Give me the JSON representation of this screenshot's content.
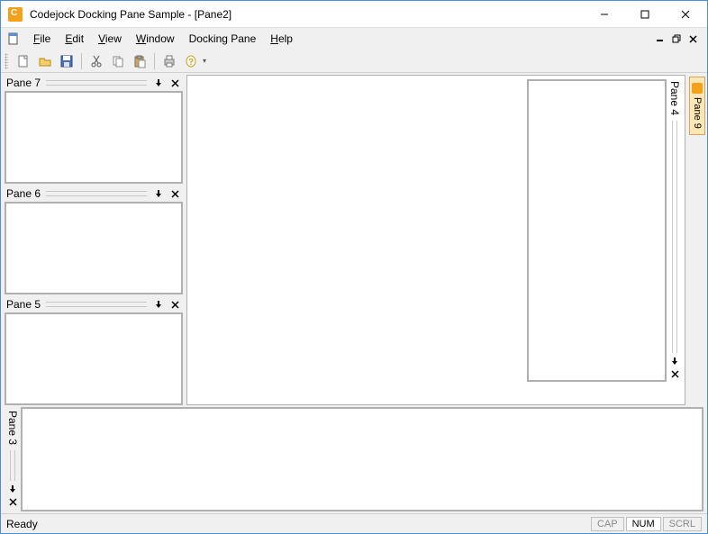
{
  "window": {
    "title": "Codejock Docking Pane Sample - [Pane2]"
  },
  "menu": {
    "file": "File",
    "edit": "Edit",
    "view": "View",
    "window": "Window",
    "docking_pane": "Docking Pane",
    "help": "Help"
  },
  "toolbar": {
    "new": "new",
    "open": "open",
    "save": "save",
    "cut": "cut",
    "copy": "copy",
    "paste": "paste",
    "print": "print",
    "about": "about"
  },
  "panes": {
    "p7": {
      "title": "Pane 7"
    },
    "p6": {
      "title": "Pane 6"
    },
    "p5": {
      "title": "Pane 5"
    },
    "p4": {
      "title": "Pane 4"
    },
    "p3": {
      "title": "Pane 3"
    },
    "p9_tab": {
      "label": "Pane 9"
    }
  },
  "status": {
    "ready": "Ready",
    "cap": "CAP",
    "num": "NUM",
    "scrl": "SCRL"
  }
}
